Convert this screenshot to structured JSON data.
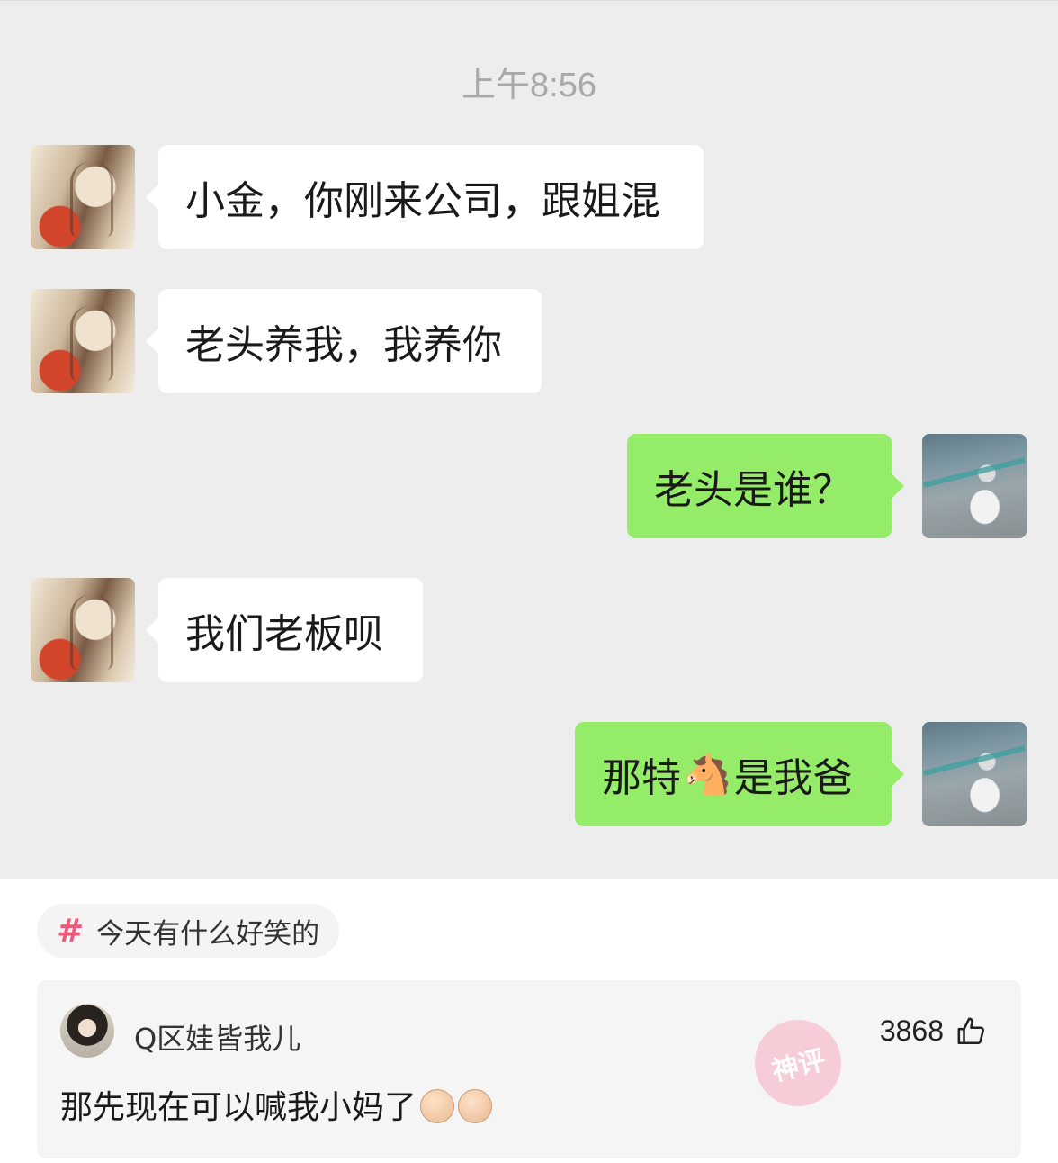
{
  "chat": {
    "timestamp": "上午8:56",
    "messages": [
      {
        "side": "in",
        "text": "小金，你刚来公司，跟姐混"
      },
      {
        "side": "in",
        "text": "老头养我，我养你"
      },
      {
        "side": "out",
        "text": "老头是谁？"
      },
      {
        "side": "in",
        "text": "我们老板呗"
      },
      {
        "side": "out",
        "text_before": "那特",
        "emoji": "🐴",
        "text_after": "是我爸"
      }
    ]
  },
  "topic": {
    "hash": "#",
    "label": "今天有什么好笑的"
  },
  "comment": {
    "username": "Q区娃皆我儿",
    "likes": "3868",
    "text": "那先现在可以喊我小妈了",
    "stamp_label": "神评"
  },
  "icons": {
    "incoming_avatar": "girl-illustration-avatar",
    "outgoing_avatar": "scooter-photo-avatar",
    "like": "thumbs-up-icon",
    "emoji": "smirk-face-icon"
  },
  "colors": {
    "chat_bg": "#ededed",
    "bubble_in": "#ffffff",
    "bubble_out": "#95ec69",
    "hash": "#f0577a"
  }
}
